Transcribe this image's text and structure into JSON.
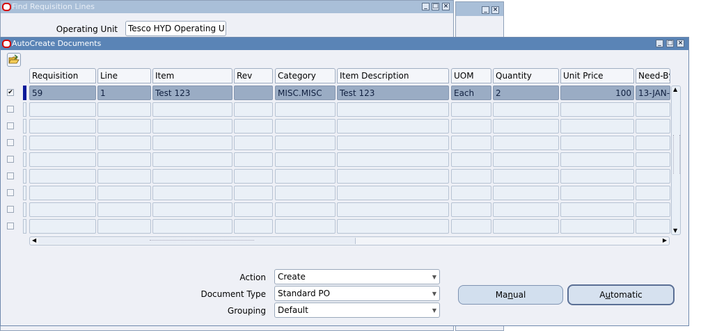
{
  "bg_window": {
    "title": "Find Requisition Lines",
    "operating_unit_label": "Operating Unit",
    "operating_unit_value": "Tesco HYD Operating U"
  },
  "main_window": {
    "title": "AutoCreate Documents",
    "columns": [
      "Requisition",
      "Line",
      "Item",
      "Rev",
      "Category",
      "Item Description",
      "UOM",
      "Quantity",
      "Unit Price",
      "Need-By"
    ],
    "rows": [
      {
        "selected": true,
        "cells": [
          "59",
          "1",
          "Test 123",
          "",
          "MISC.MISC",
          "Test 123",
          "Each",
          "2",
          "100",
          "13-JAN-"
        ]
      },
      {
        "selected": false,
        "cells": [
          "",
          "",
          "",
          "",
          "",
          "",
          "",
          "",
          "",
          ""
        ]
      },
      {
        "selected": false,
        "cells": [
          "",
          "",
          "",
          "",
          "",
          "",
          "",
          "",
          "",
          ""
        ]
      },
      {
        "selected": false,
        "cells": [
          "",
          "",
          "",
          "",
          "",
          "",
          "",
          "",
          "",
          ""
        ]
      },
      {
        "selected": false,
        "cells": [
          "",
          "",
          "",
          "",
          "",
          "",
          "",
          "",
          "",
          ""
        ]
      },
      {
        "selected": false,
        "cells": [
          "",
          "",
          "",
          "",
          "",
          "",
          "",
          "",
          "",
          ""
        ]
      },
      {
        "selected": false,
        "cells": [
          "",
          "",
          "",
          "",
          "",
          "",
          "",
          "",
          "",
          ""
        ]
      },
      {
        "selected": false,
        "cells": [
          "",
          "",
          "",
          "",
          "",
          "",
          "",
          "",
          "",
          ""
        ]
      },
      {
        "selected": false,
        "cells": [
          "",
          "",
          "",
          "",
          "",
          "",
          "",
          "",
          "",
          ""
        ]
      }
    ],
    "action": {
      "label": "Action",
      "value": "Create"
    },
    "document_type": {
      "label": "Document Type",
      "value": "Standard PO"
    },
    "grouping": {
      "label": "Grouping",
      "value": "Default"
    },
    "manual_button": {
      "pre": "Ma",
      "key": "n",
      "post": "ual"
    },
    "automatic_button": {
      "pre": "A",
      "key": "u",
      "post": "tomatic"
    }
  },
  "colors": {
    "title_active": "#5a84b6",
    "title_inactive": "#a9bfd8",
    "selected_row": "#9aacc4",
    "window_bg": "#eef0f6"
  }
}
